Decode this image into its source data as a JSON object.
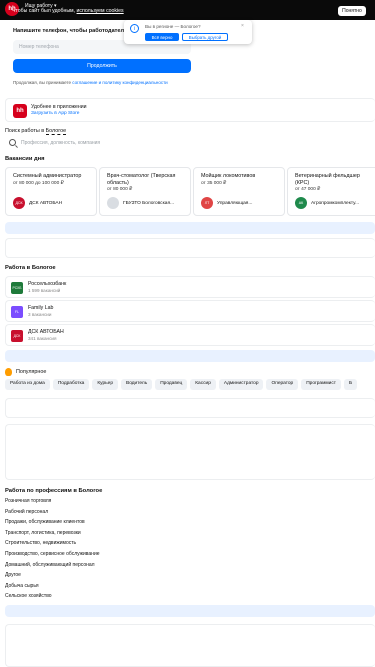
{
  "header": {
    "logo": "hh",
    "search_work": "Ищу работу ▾",
    "cookie_text_pre": "Чтобы сайт был удобным, ",
    "cookie_text_link": "используем cookies",
    "cookie_button": "Понятно"
  },
  "phone_form": {
    "title": "Напишите телефон, чтобы работодатели могли",
    "placeholder": "Номер телефона",
    "submit": "Продолжить",
    "agree_pre": "Продолжая, вы принимаете ",
    "agree_link": "соглашение и политику конфиденциальности"
  },
  "region_popup": {
    "question": "Вы в регионе — Бологое?",
    "yes": "Всё верно",
    "other": "Выбрать другой",
    "close": "×",
    "info": "i"
  },
  "app_promo": {
    "logo": "hh",
    "title": "Удобнее в приложении",
    "link": "Загрузить в App Store"
  },
  "search": {
    "label_pre": "Поиск работы в ",
    "label_city": "Бологое",
    "placeholder": "Профессия, должность, компания"
  },
  "vacancies": {
    "title": "Вакансии дня",
    "items": [
      {
        "title": "Системный администратор",
        "salary": "от 80 000 до 100 000 ₽",
        "company": "ДСК АВТОБАН",
        "logo_text": "ДСК",
        "logo_color": "#c8102e"
      },
      {
        "title": "Врач-стоматолог (Тверская область)",
        "salary": "от 80 000 ₽",
        "company": "ГБУЗТО Бологовская...",
        "logo_text": "",
        "logo_color": "#d9dde2"
      },
      {
        "title": "Мойщик локомотивов",
        "salary": "от 35 000 ₽",
        "company": "Управляющая...",
        "logo_text": "ЛТ",
        "logo_color": "#e04545"
      },
      {
        "title": "Ветеринарный фельдшер (КРС)",
        "salary": "от 47 000 ₽",
        "company": "Агропромкомплекту...",
        "logo_text": "АК",
        "logo_color": "#1f8a4c"
      }
    ]
  },
  "companies": {
    "title": "Работа в Бологое",
    "items": [
      {
        "name": "Россельхозбанк",
        "count": "1 599 вакансий",
        "logo_text": "РСХБ",
        "logo_color": "#1e7a3a"
      },
      {
        "name": "Family Lab",
        "count": "3 вакансии",
        "logo_text": "FL",
        "logo_color": "#7b4dff"
      },
      {
        "name": "ДСК АВТОБАН",
        "count": "341 вакансия",
        "logo_text": "ДСК",
        "logo_color": "#c8102e"
      }
    ]
  },
  "popular": {
    "title": "Популярное",
    "chips": [
      "Работа из дома",
      "Подработка",
      "Курьер",
      "Водитель",
      "Продавец",
      "Кассир",
      "Администратор",
      "Оператор",
      "Программист",
      "Б"
    ]
  },
  "professions": {
    "title": "Работа по профессиям в Бологое",
    "items": [
      "Розничная торговля",
      "Рабочий персонал",
      "Продажи, обслуживание клиентов",
      "Транспорт, логистика, перевозки",
      "Строительство, недвижимость",
      "Производство, сервисное обслуживание",
      "Домашний, обслуживающий персонал",
      "Другое",
      "Добыча сырья",
      "Сельское хозяйство"
    ]
  }
}
